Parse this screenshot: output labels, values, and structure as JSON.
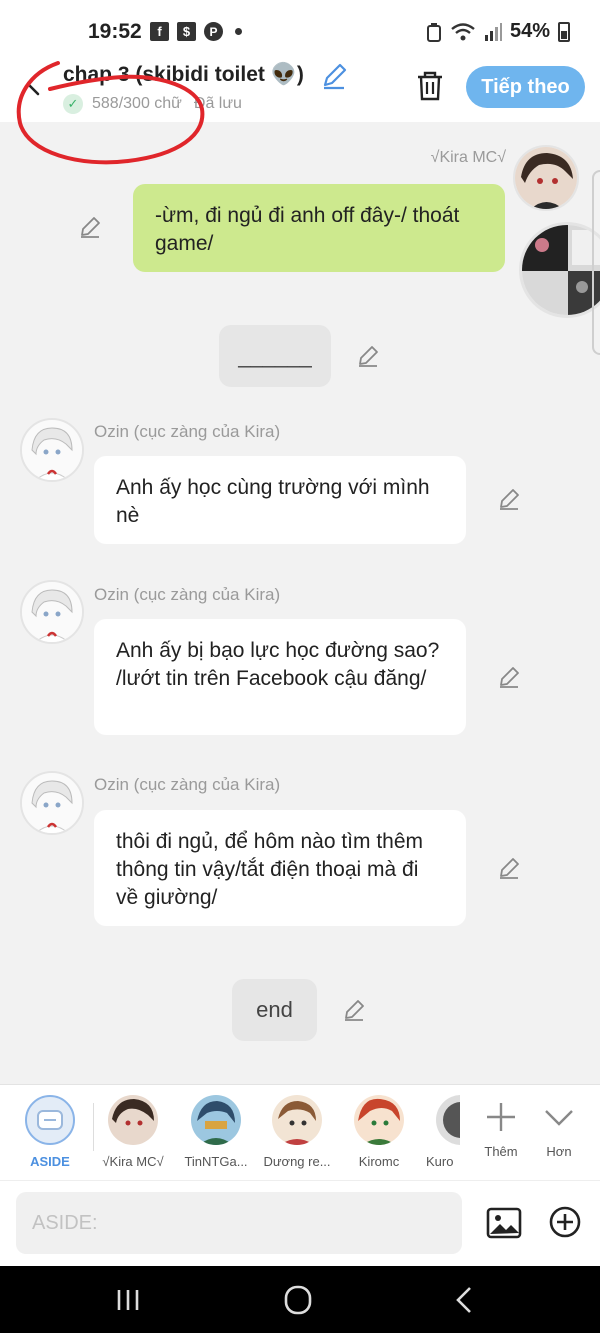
{
  "status_bar": {
    "time": "19:52",
    "battery": "54%",
    "icons": [
      "facebook-icon",
      "money-app-icon",
      "pinterest-icon",
      "notification-dot-icon",
      "recycle-icon",
      "wifi-icon",
      "signal-icon",
      "battery-icon"
    ]
  },
  "header": {
    "title": "chap 3 (skibidi toilet 👽)",
    "word_count": "588/300 chữ",
    "saved": "Đã lưu",
    "next_label": "Tiếp theo"
  },
  "messages": [
    {
      "type": "right",
      "sender": "√Kira MC√",
      "text": "-ừm, đi ngủ đi anh off đây-/ thoát game/"
    },
    {
      "type": "center",
      "text": "______"
    },
    {
      "type": "left",
      "sender": "Ozin (cục zàng của Kira)",
      "text": "Anh ấy học cùng trường với mình nè"
    },
    {
      "type": "left",
      "sender": "Ozin (cục zàng của Kira)",
      "text": "Anh ấy bị bạo lực học đường sao? /lướt tin trên Facebook cậu đăng/"
    },
    {
      "type": "left",
      "sender": "Ozin (cục zàng của Kira)",
      "text": "thôi đi ngủ, để hôm nào tìm thêm thông tin vậy/tắt điện thoại mà đi về giường/"
    },
    {
      "type": "center",
      "text": "end"
    }
  ],
  "characters": [
    {
      "label": "ASIDE"
    },
    {
      "label": "√Kira MC√"
    },
    {
      "label": "TinNTGa..."
    },
    {
      "label": "Dương re..."
    },
    {
      "label": "Kiromc"
    },
    {
      "label": "Kuro"
    }
  ],
  "actions": {
    "more": "Thêm",
    "expand": "Hơn"
  },
  "input": {
    "placeholder": "ASIDE:",
    "value": ""
  },
  "colors": {
    "accent": "#6fb5ee",
    "my_bubble": "#cde98e",
    "annotation_red": "#e0262b"
  }
}
